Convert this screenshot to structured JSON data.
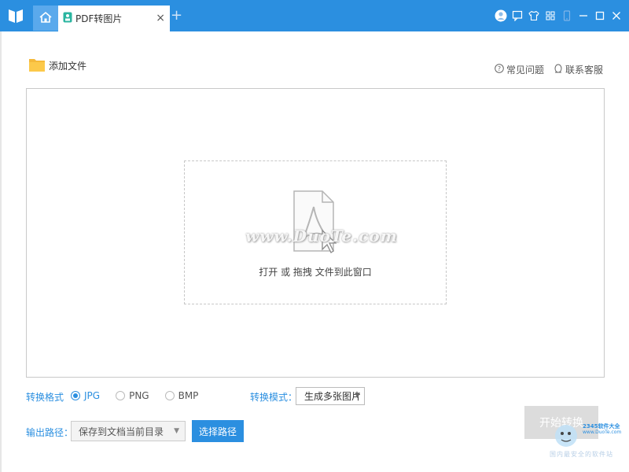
{
  "titlebar": {
    "tab_title": "PDF转图片",
    "close_label": "×",
    "new_tab_label": "+",
    "accent_color": "#2b8fe0",
    "icons": [
      "user-icon",
      "message-icon",
      "skin-icon",
      "apps-icon",
      "phone-icon",
      "minimize-icon",
      "maximize-icon",
      "close-icon"
    ]
  },
  "toolbar": {
    "add_file_label": "添加文件",
    "faq_label": "常见问题",
    "support_label": "联系客服"
  },
  "drop_zone": {
    "hint_text": "打开 或 拖拽 文件到此窗口",
    "watermark_text": "www.DuoTe.com"
  },
  "options": {
    "format_label": "转换格式",
    "formats": [
      "JPG",
      "PNG",
      "BMP"
    ],
    "selected_format": "JPG",
    "mode_label": "转换模式：",
    "mode_value": "生成多张图片",
    "output_label": "输出路径：",
    "output_value": "保存到文档当前目录",
    "choose_path_label": "选择路径",
    "start_label": "开始转换"
  },
  "overlay": {
    "badge_line1": "2345软件大全",
    "badge_line2": "www.DuoTe.com",
    "bottom_text": "国内最安全的软件站"
  }
}
